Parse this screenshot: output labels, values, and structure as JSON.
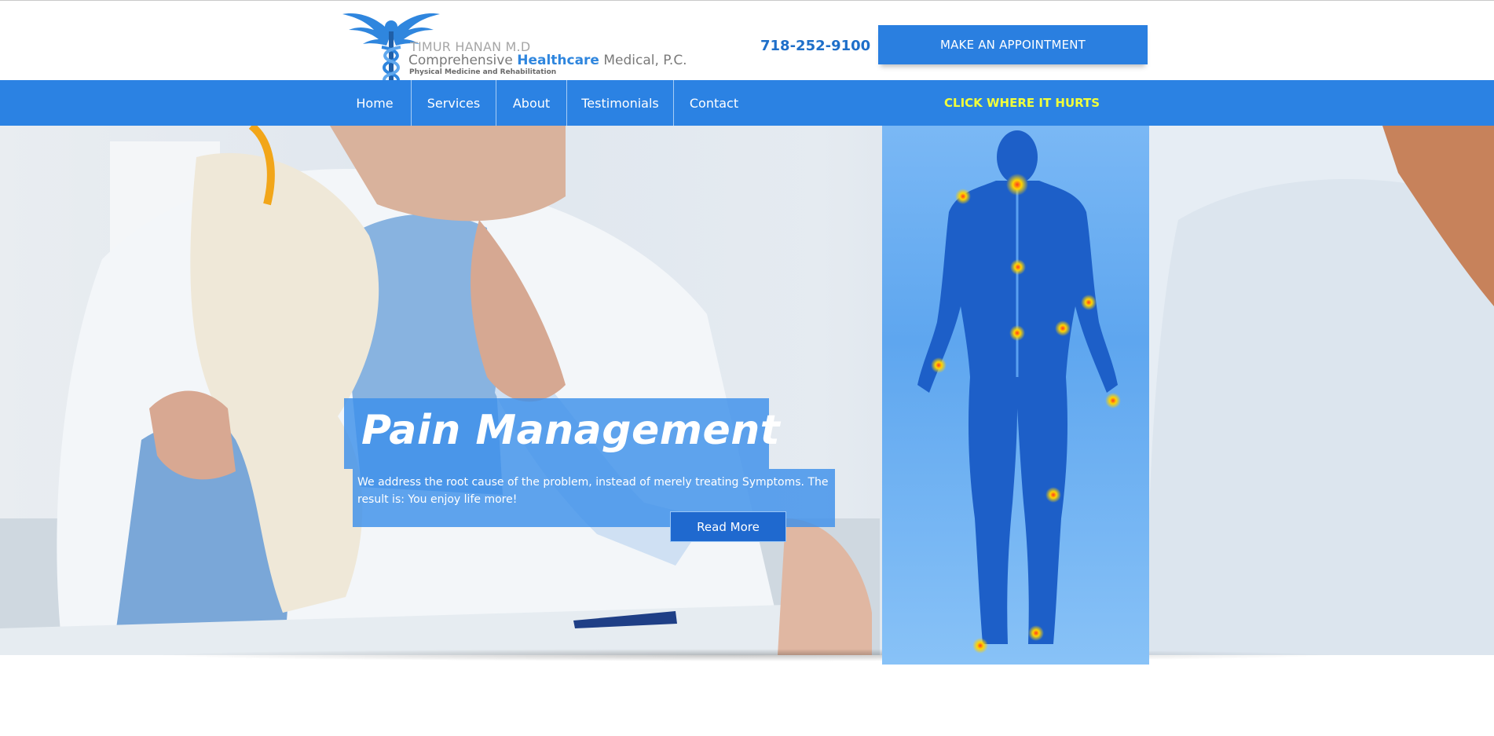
{
  "header": {
    "logo": {
      "line1": "TIMUR HANAN M.D",
      "line2_prefix": "Comprehensive ",
      "line2_highlight": "Healthcare",
      "line2_suffix": " Medical, P.C.",
      "line3": "Physical Medicine and Rehabilitation",
      "icon": "caduceus-icon"
    },
    "phone": "718-252-9100",
    "appointment_button": "MAKE AN APPOINTMENT"
  },
  "nav": {
    "items": [
      {
        "label": "Home"
      },
      {
        "label": "Services"
      },
      {
        "label": "About"
      },
      {
        "label": "Testimonials"
      },
      {
        "label": "Contact"
      }
    ],
    "cta": "CLICK WHERE IT HURTS"
  },
  "hero": {
    "title": "Pain Management",
    "description": "We address the root cause of the problem, instead of merely treating Symptoms. The result is: You enjoy life more!",
    "button": "Read More"
  },
  "colors": {
    "brand_blue": "#2b82e3",
    "button_blue": "#2a7fe0",
    "cta_yellow": "#f2ff3a",
    "phone_blue": "#1e6fc9"
  }
}
